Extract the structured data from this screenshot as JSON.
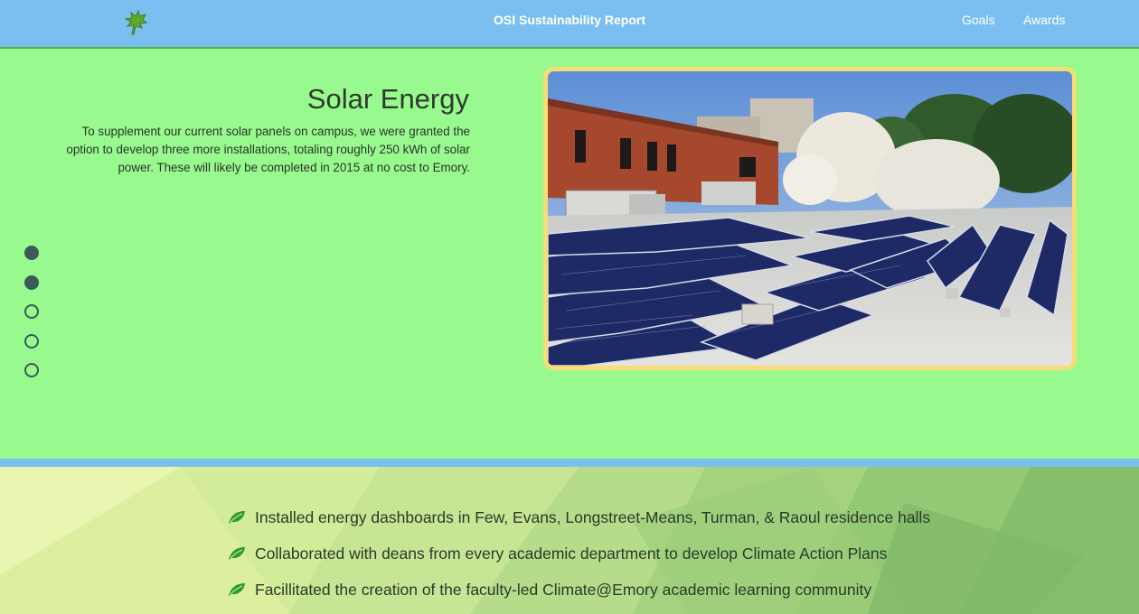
{
  "header": {
    "logo_icon": "leaf-logo-icon",
    "brand": "OSI Sustainability Report",
    "nav": [
      {
        "label": "Goals"
      },
      {
        "label": "Awards"
      }
    ]
  },
  "hero": {
    "title": "Solar Energy",
    "text": "To supplement our current solar panels on campus, we were granted the option to develop three more installations, totaling roughly 250 kWh of solar power. These will likely be completed in 2015 at no cost to Emory.",
    "slides": [
      {
        "active": true
      },
      {
        "active": true
      },
      {
        "active": false
      },
      {
        "active": false
      },
      {
        "active": false
      }
    ]
  },
  "achievements": [
    {
      "icon": "leaf-icon",
      "text": "Installed energy dashboards in Few, Evans, Longstreet-Means, Turman, & Raoul residence halls"
    },
    {
      "icon": "leaf-icon",
      "text": "Collaborated with deans from every academic department to develop Climate Action Plans"
    },
    {
      "icon": "leaf-icon",
      "text": "Facillitated the creation of the faculty-led Climate@Emory academic learning community"
    }
  ],
  "colors": {
    "navbar": "#7bbff0",
    "hero_bg": "#98f98e",
    "photo_border": "#f7dd75",
    "leaf": "#2e9a2e"
  }
}
